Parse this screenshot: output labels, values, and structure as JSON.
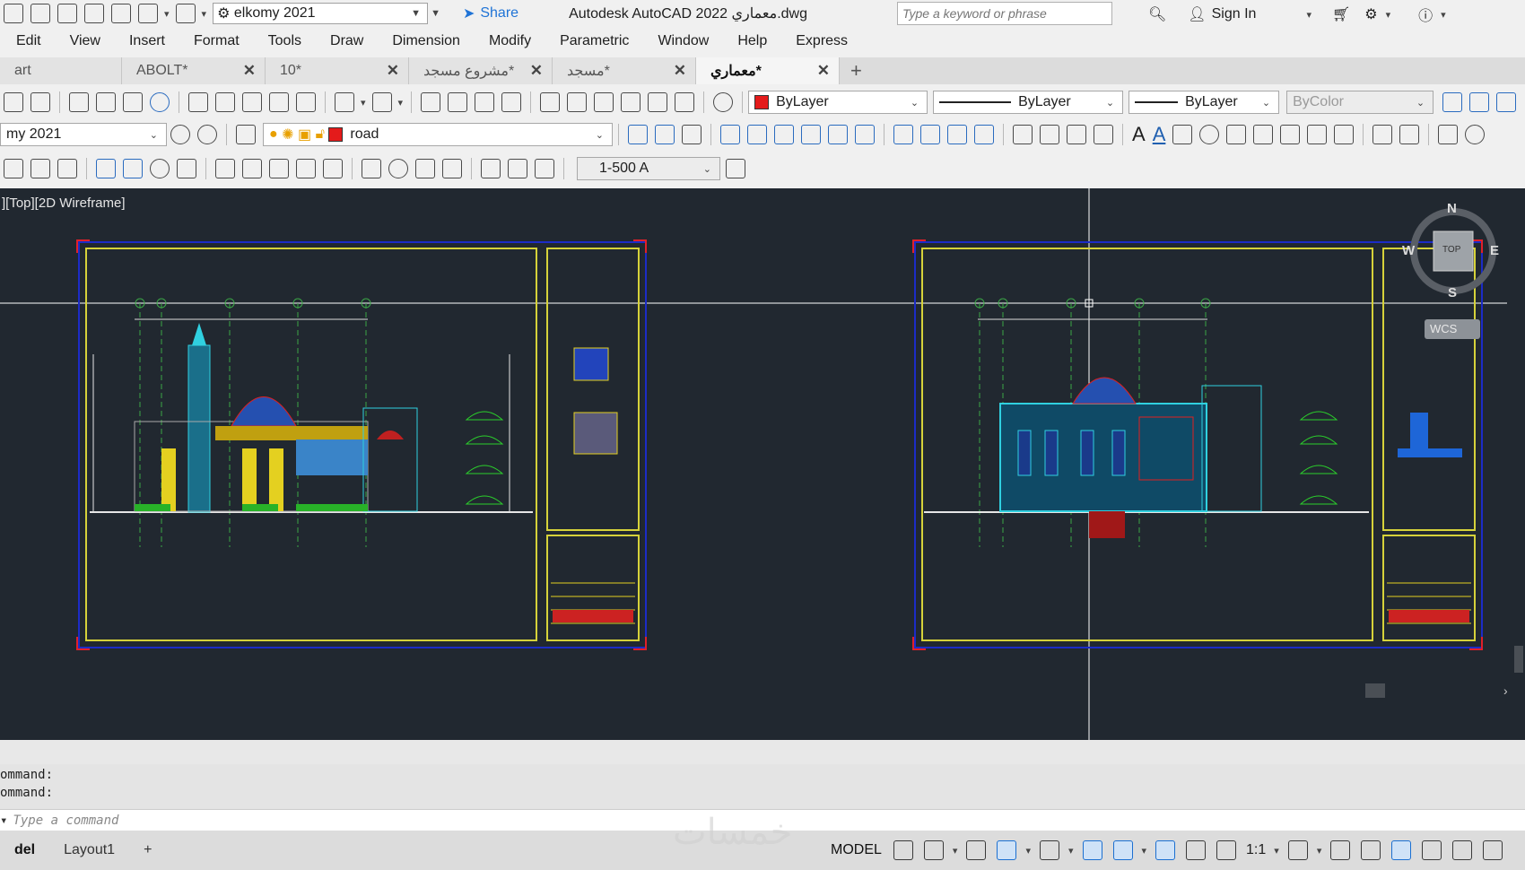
{
  "titlebar": {
    "workspace": "elkomy 2021",
    "share_label": "Share",
    "app_title": "Autodesk AutoCAD 2022  معماري.dwg",
    "search_placeholder": "Type a keyword or phrase",
    "signin_label": "Sign In"
  },
  "menu": [
    "Edit",
    "View",
    "Insert",
    "Format",
    "Tools",
    "Draw",
    "Dimension",
    "Modify",
    "Parametric",
    "Window",
    "Help",
    "Express"
  ],
  "tabs": [
    {
      "label": "art",
      "closable": false
    },
    {
      "label": "ABOLT*",
      "closable": true
    },
    {
      "label": "10*",
      "closable": true
    },
    {
      "label": "مشروع مسجد*",
      "closable": true
    },
    {
      "label": "مسجد*",
      "closable": true
    },
    {
      "label": "معماري*",
      "closable": true,
      "active": true
    }
  ],
  "toolbar1": {
    "color": "ByLayer",
    "color_swatch": "#e41b1b",
    "linetype": "ByLayer",
    "lineweight": "ByLayer",
    "plotstyle": "ByColor"
  },
  "toolbar2": {
    "textstyle": "my 2021",
    "layer": "road",
    "layer_swatch": "#e41b1b"
  },
  "toolbar3": {
    "dimscale": "1-500 A"
  },
  "viewport": {
    "label": "][Top][2D Wireframe]",
    "viewcube": {
      "n": "N",
      "s": "S",
      "e": "E",
      "w": "W",
      "top": "TOP",
      "wcs": "WCS"
    }
  },
  "command": {
    "history": [
      "ommand:",
      "ommand:"
    ],
    "placeholder": "Type a command"
  },
  "layouts": {
    "model_tab": "del",
    "layout1": "Layout1",
    "plus": "+"
  },
  "status": {
    "model": "MODEL",
    "scale": "1:1"
  },
  "watermark": "خمسات"
}
